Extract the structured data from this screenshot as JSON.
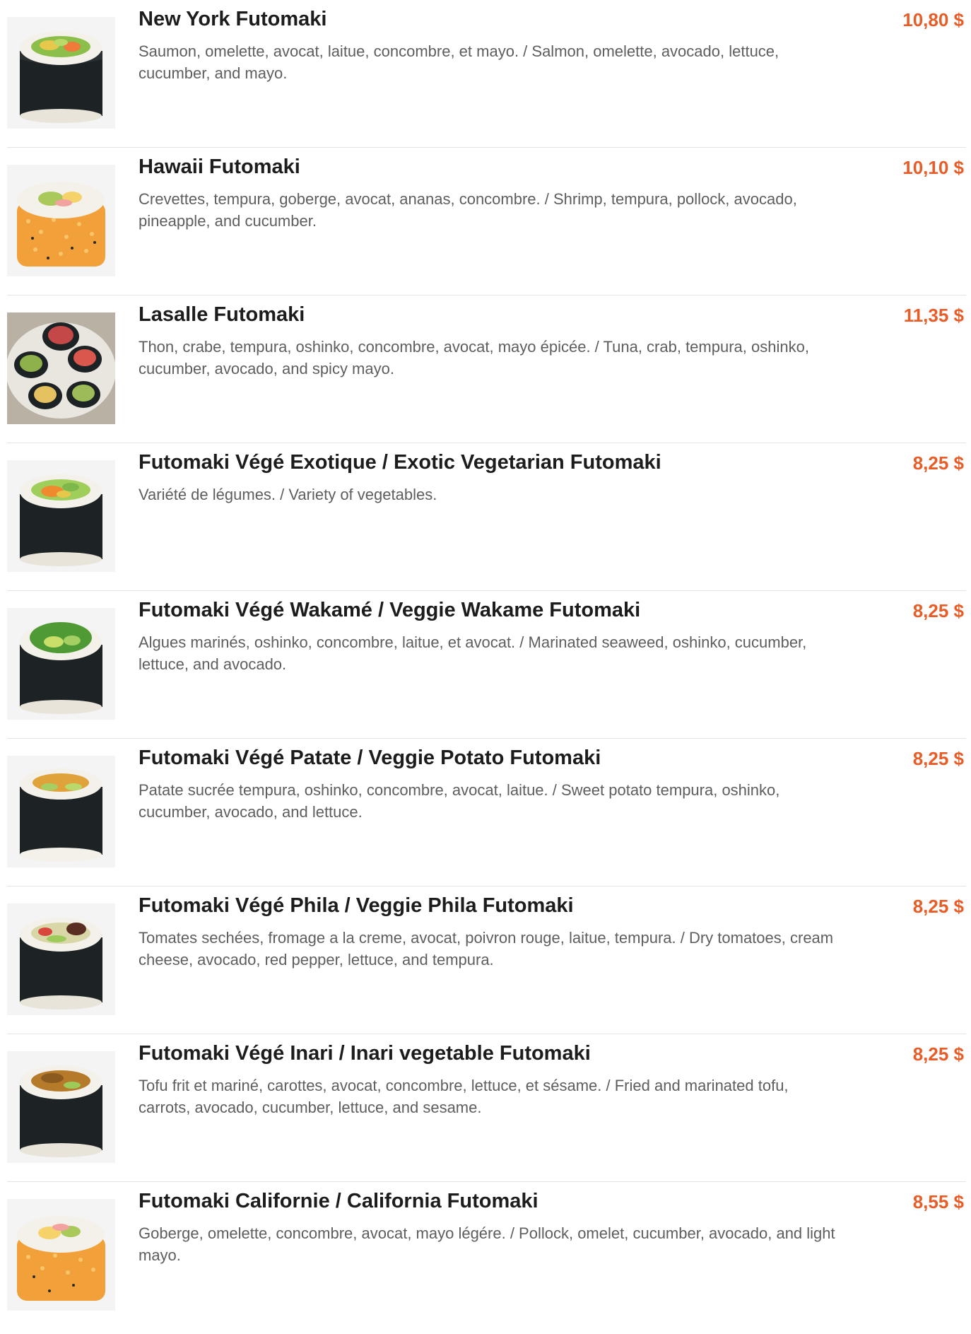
{
  "menu": {
    "items": [
      {
        "name": "New York Futomaki",
        "description": "Saumon, omelette, avocat, laitue, concombre, et mayo. / Salmon, omelette, avocado, lettuce, cucumber, and mayo.",
        "price": "10,80 $",
        "image": "futomaki-roll-photo"
      },
      {
        "name": "Hawaii Futomaki",
        "description": "Crevettes, tempura, goberge, avocat, ananas, concombre. / Shrimp, tempura, pollock, avocado, pineapple, and cucumber.",
        "price": "10,10 $",
        "image": "orange-roe-roll-photo"
      },
      {
        "name": "Lasalle Futomaki",
        "description": "Thon, crabe, tempura, oshinko, concombre, avocat, mayo épicée. / Tuna, crab, tempura, oshinko, cucumber, avocado, and spicy mayo.",
        "price": "11,35 $",
        "image": "plated-rolls-photo"
      },
      {
        "name": "Futomaki Végé Exotique / Exotic Vegetarian Futomaki",
        "description": "Variété de légumes. / Variety of vegetables.",
        "price": "8,25 $",
        "image": "futomaki-roll-photo"
      },
      {
        "name": "Futomaki Végé Wakamé / Veggie Wakame Futomaki",
        "description": "Algues marinés, oshinko, concombre, laitue, et avocat. / Marinated seaweed, oshinko, cucumber, lettuce, and avocado.",
        "price": "8,25 $",
        "image": "futomaki-roll-photo"
      },
      {
        "name": "Futomaki Végé Patate / Veggie Potato Futomaki",
        "description": "Patate sucrée tempura, oshinko, concombre, avocat, laitue. / Sweet potato tempura, oshinko, cucumber, avocado, and lettuce.",
        "price": "8,25 $",
        "image": "futomaki-roll-photo"
      },
      {
        "name": "Futomaki Végé Phila / Veggie Phila Futomaki",
        "description": "Tomates sechées, fromage a la creme, avocat, poivron rouge, laitue, tempura. / Dry tomatoes, cream cheese, avocado, red pepper, lettuce, and tempura.",
        "price": "8,25 $",
        "image": "futomaki-roll-photo"
      },
      {
        "name": "Futomaki Végé Inari / Inari vegetable Futomaki",
        "description": "Tofu frit et mariné, carottes, avocat, concombre, lettuce, et sésame. / Fried and marinated tofu, carrots, avocado, cucumber, lettuce, and sesame.",
        "price": "8,25 $",
        "image": "futomaki-roll-photo"
      },
      {
        "name": "Futomaki Californie / California Futomaki",
        "description": "Goberge, omelette, concombre, avocat, mayo légére. / Pollock, omelet, cucumber, avocado, and light mayo.",
        "price": "8,55 $",
        "image": "orange-roe-roll-photo"
      }
    ]
  },
  "colors": {
    "price": "#e85d27",
    "title": "#1c1c1c",
    "description": "#5e5e5e",
    "divider": "#e4e4e4",
    "nori": "#1d2224",
    "rice": "#f4f1ea",
    "roe": "#f2a03a"
  }
}
